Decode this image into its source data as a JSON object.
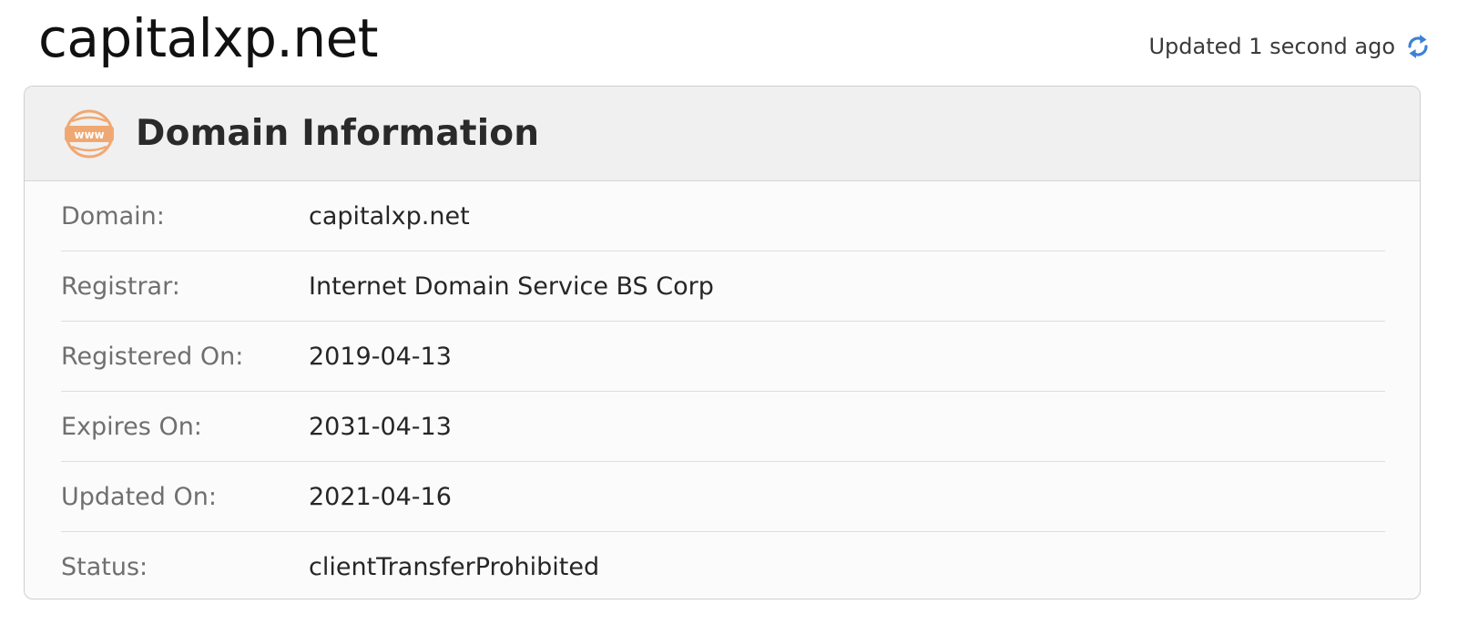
{
  "header": {
    "title": "capitalxp.net",
    "updated_text": "Updated 1 second ago",
    "refresh_icon": "refresh-icon"
  },
  "card": {
    "icon": "www-icon",
    "title": "Domain Information",
    "rows": [
      {
        "label": "Domain:",
        "value": "capitalxp.net"
      },
      {
        "label": "Registrar:",
        "value": "Internet Domain Service BS Corp"
      },
      {
        "label": "Registered On:",
        "value": "2019-04-13"
      },
      {
        "label": "Expires On:",
        "value": "2031-04-13"
      },
      {
        "label": "Updated On:",
        "value": "2021-04-16"
      },
      {
        "label": "Status:",
        "value": "clientTransferProhibited"
      }
    ]
  },
  "colors": {
    "accent_orange": "#f0a872",
    "refresh_blue": "#3b82d6"
  }
}
